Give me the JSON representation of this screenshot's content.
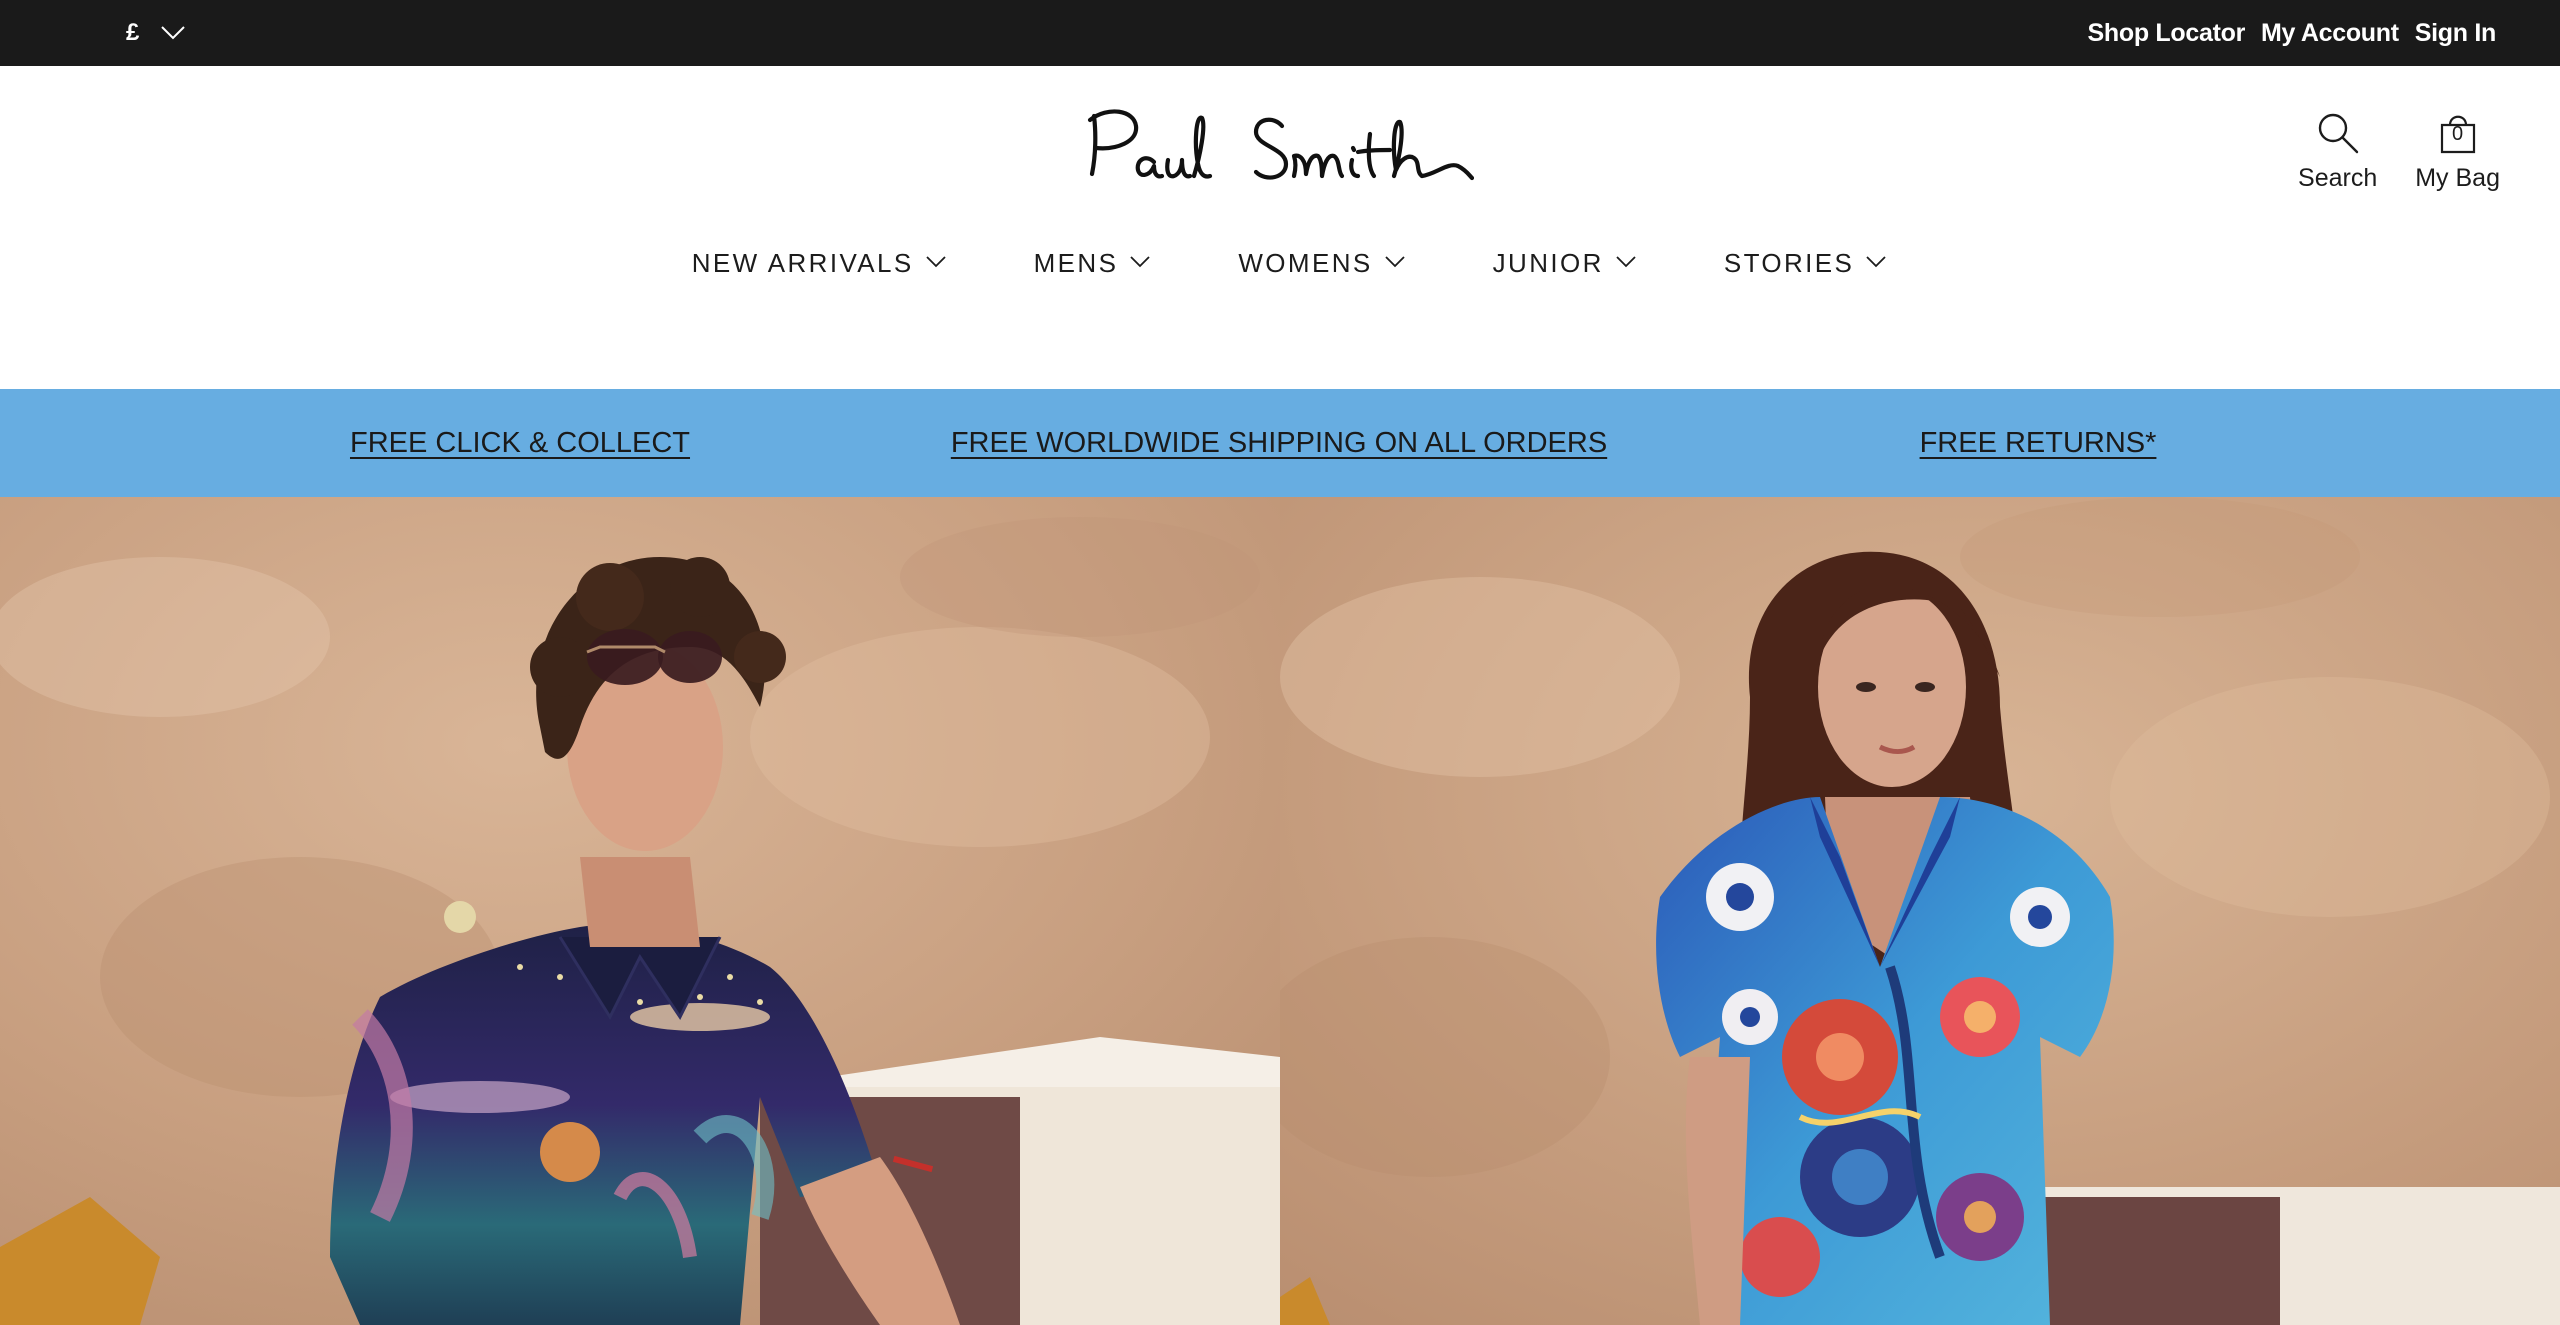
{
  "topbar": {
    "currency": "£",
    "links": [
      "Shop Locator",
      "My Account",
      "Sign In"
    ]
  },
  "header": {
    "logo_text": "Paul Smith",
    "tools": {
      "search_label": "Search",
      "bag_label": "My Bag",
      "bag_count": "0"
    }
  },
  "nav": {
    "items": [
      "NEW ARRIVALS",
      "MENS",
      "WOMENS",
      "JUNIOR",
      "STORIES"
    ]
  },
  "promo": {
    "items": [
      "FREE CLICK & COLLECT",
      "FREE WORLDWIDE SHIPPING ON ALL ORDERS",
      "FREE RETURNS*"
    ]
  },
  "icons": {
    "currency_dropdown": "chevron-down-icon",
    "search": "search-icon",
    "bag": "shopping-bag-icon",
    "nav_dropdown": "chevron-down-icon"
  },
  "colors": {
    "topbar": "#1a1a1a",
    "promo_bar": "#67ade1",
    "hero_background": "#c9a385",
    "text": "#1c1c1c"
  }
}
